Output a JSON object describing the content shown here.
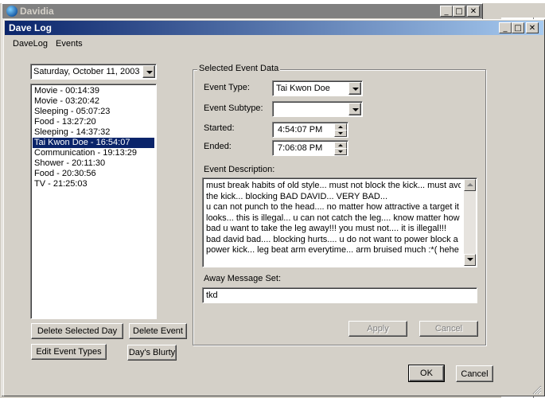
{
  "outer_window": {
    "title": "Davidia",
    "buttons": [
      "_",
      "□",
      "✕"
    ]
  },
  "dialog": {
    "title": "Dave Log",
    "buttons": [
      "_",
      "□",
      "✕"
    ]
  },
  "menu": [
    {
      "label": "DaveLog"
    },
    {
      "label": "Events"
    }
  ],
  "date_picker": {
    "value": "Saturday, October 11, 2003"
  },
  "event_list": {
    "items": [
      "Movie - 00:14:39",
      "Movie - 03:20:42",
      "Sleeping - 05:07:23",
      "Food - 13:27:20",
      "Sleeping - 14:37:32",
      "Tai Kwon Doe - 16:54:07",
      "Communication - 19:13:29",
      "Shower - 20:11:30",
      "Food - 20:30:56",
      "TV - 21:25:03"
    ],
    "selected_index": 5
  },
  "buttons": {
    "delete_selected_day": "Delete Selected Day",
    "delete_event": "Delete Event",
    "edit_event_types": "Edit Event Types",
    "days_blurty": "Day's Blurty",
    "apply": "Apply",
    "cancel_inner": "Cancel",
    "ok": "OK",
    "cancel": "Cancel"
  },
  "selected_event": {
    "group_label": "Selected Event Data",
    "event_type_label": "Event Type:",
    "event_type_value": "Tai Kwon Doe",
    "event_subtype_label": "Event Subtype:",
    "event_subtype_value": "",
    "started_label": "Started:",
    "started_value": "4:54:07 PM",
    "ended_label": "Ended:",
    "ended_value": "7:06:08 PM",
    "description_label": "Event Description:",
    "description_lines": [
      "must break habits of old style... must not block the kick... must avoid",
      "the kick... blocking BAD DAVID... VERY BAD...",
      "u can not punch to the head.... no matter how attractive a target it",
      "looks... this is illegal... u can not catch the leg.... know matter how",
      "bad u want to take the leg away!!! you must not.... it is illegal!!!",
      "bad david bad.... blocking hurts.... u do not want to power block a",
      "power kick... leg beat arm everytime... arm bruised much :*( hehe"
    ],
    "away_message_label": "Away Message Set:",
    "away_message_value": "tkd"
  }
}
